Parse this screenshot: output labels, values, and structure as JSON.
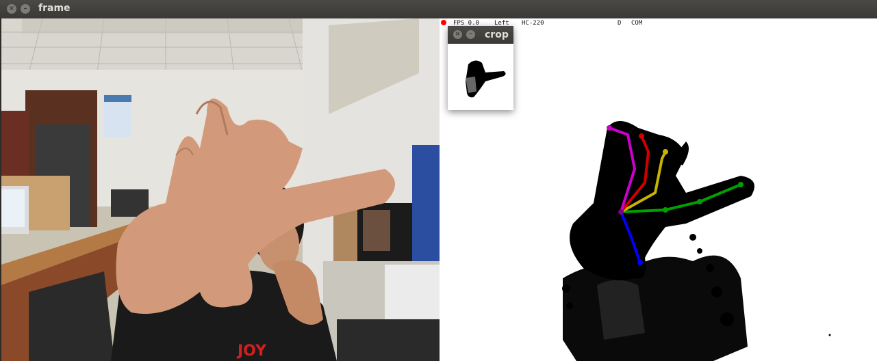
{
  "window": {
    "title": "frame",
    "close_glyph": "×",
    "minimize_glyph": "–"
  },
  "hud": {
    "fps": "FPS 0.0",
    "hand": "Left",
    "model": "HC-220",
    "mode_d": "D",
    "mode_com": "COM",
    "status_color": "#ff0000"
  },
  "crop_window": {
    "title": "crop"
  },
  "skeleton_colors": {
    "thumb": "#0000ff",
    "index": "#00a000",
    "middle": "#c8b400",
    "ring": "#d00000",
    "pinky": "#cc00cc",
    "palm": "#800080"
  },
  "camera_scene": {
    "shirt_text": "JOY"
  }
}
